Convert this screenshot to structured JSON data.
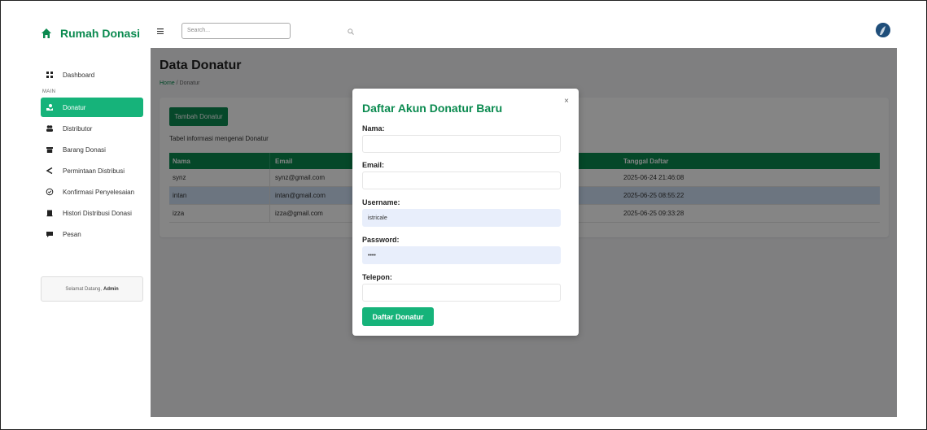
{
  "brand": {
    "name": "Rumah Donasi"
  },
  "topbar": {
    "search_placeholder": "Search..."
  },
  "sidebar": {
    "items_main": [
      {
        "label": "Dashboard",
        "icon": "grid-icon"
      }
    ],
    "section_label": "MAIN",
    "items": [
      {
        "label": "Donatur",
        "icon": "hand-icon",
        "active": true
      },
      {
        "label": "Distributor",
        "icon": "users-icon"
      },
      {
        "label": "Barang Donasi",
        "icon": "box-icon"
      },
      {
        "label": "Permintaan Distribusi",
        "icon": "share-icon"
      },
      {
        "label": "Konfirmasi Penyelesaian",
        "icon": "check-circle-icon"
      },
      {
        "label": "Histori Distribusi Donasi",
        "icon": "history-icon"
      },
      {
        "label": "Pesan",
        "icon": "message-icon"
      }
    ],
    "welcome_prefix": "Selamat Datang,",
    "welcome_user": "Admin"
  },
  "page": {
    "title": "Data Donatur",
    "breadcrumb_home": "Home",
    "breadcrumb_sep": " / ",
    "breadcrumb_current": "Donatur"
  },
  "card": {
    "add_button": "Tambah Donatur",
    "caption": "Tabel informasi mengenai Donatur",
    "columns": [
      "Nama",
      "Email",
      "Tanggal Daftar"
    ],
    "rows": [
      {
        "nama": "synz",
        "email": "synz@gmail.com",
        "tanggal": "2025-06-24 21:46:08"
      },
      {
        "nama": "intan",
        "email": "intan@gmail.com",
        "tanggal": "2025-06-25 08:55:22"
      },
      {
        "nama": "izza",
        "email": "izza@gmail.com",
        "tanggal": "2025-06-25 09:33:28"
      }
    ]
  },
  "modal": {
    "title": "Daftar Akun Donatur Baru",
    "close": "×",
    "labels": {
      "nama": "Nama:",
      "email": "Email:",
      "username": "Username:",
      "password": "Password:",
      "telepon": "Telepon:"
    },
    "values": {
      "nama": "",
      "email": "",
      "username": "istricale",
      "password": "••••",
      "telepon": ""
    },
    "submit": "Daftar Donatur"
  },
  "colors": {
    "brand_green": "#0a8a4f",
    "active_green": "#16b37a",
    "row_selected": "#cfe0f5"
  }
}
